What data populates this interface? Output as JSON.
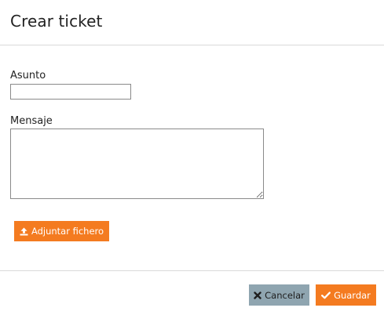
{
  "modal": {
    "title": "Crear ticket"
  },
  "form": {
    "subject": {
      "label": "Asunto",
      "value": "",
      "placeholder": ""
    },
    "message": {
      "label": "Mensaje",
      "value": "",
      "placeholder": ""
    },
    "attach_label": "Adjuntar fichero"
  },
  "footer": {
    "cancel_label": "Cancelar",
    "save_label": "Guardar"
  },
  "icons": {
    "attach": "upload-icon",
    "cancel": "close-icon",
    "save": "check-icon"
  },
  "colors": {
    "accent": "#f47b20",
    "cancel_button": "#8fa5b0"
  }
}
